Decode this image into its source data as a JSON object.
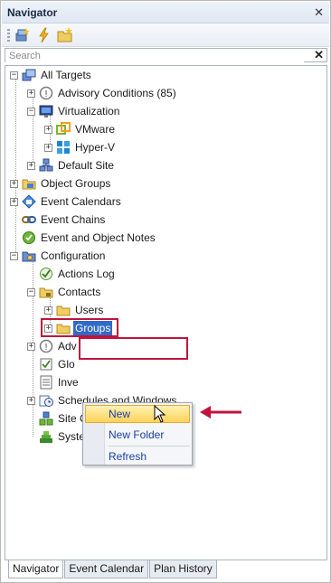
{
  "panel": {
    "title": "Navigator",
    "close_glyph": "✕"
  },
  "toolbar": {
    "buttons": [
      "new-object-icon",
      "lightning-icon",
      "new-folder-icon"
    ]
  },
  "search": {
    "placeholder": "Search",
    "value": "",
    "clear_glyph": "✕"
  },
  "tree": {
    "nodes": [
      {
        "label": "All Targets",
        "icon": "targets-icon",
        "expander": "−"
      },
      {
        "label": "Advisory Conditions (85)",
        "icon": "advisory-icon",
        "expander": "+"
      },
      {
        "label": "Virtualization",
        "icon": "monitor-icon",
        "expander": "−"
      },
      {
        "label": "VMware",
        "icon": "vmware-icon",
        "expander": "+"
      },
      {
        "label": "Hyper-V",
        "icon": "hyperv-icon",
        "expander": "+"
      },
      {
        "label": "Default Site",
        "icon": "site-icon",
        "expander": "+"
      },
      {
        "label": "Object Groups",
        "icon": "object-groups-icon",
        "expander": "+"
      },
      {
        "label": "Event Calendars",
        "icon": "calendar-icon",
        "expander": "+"
      },
      {
        "label": "Event Chains",
        "icon": "chain-icon",
        "expander": ""
      },
      {
        "label": "Event and Object Notes",
        "icon": "notes-icon",
        "expander": ""
      },
      {
        "label": "Configuration",
        "icon": "configuration-icon",
        "expander": "−"
      },
      {
        "label": "Actions Log",
        "icon": "log-icon",
        "expander": ""
      },
      {
        "label": "Contacts",
        "icon": "folder-icon",
        "expander": "−"
      },
      {
        "label": "Users",
        "icon": "folder-icon",
        "expander": "+"
      },
      {
        "label": "Groups",
        "icon": "folder-icon",
        "expander": "+"
      },
      {
        "label": "Adv",
        "icon": "advisory-icon",
        "expander": "+"
      },
      {
        "label": "Glo",
        "icon": "checklist-icon",
        "expander": ""
      },
      {
        "label": "Inve",
        "icon": "inventory-icon",
        "expander": ""
      },
      {
        "label": "Schedules and Windows",
        "icon": "schedule-icon",
        "expander": "+"
      },
      {
        "label": "Site Configuration",
        "icon": "site-config-icon",
        "expander": ""
      },
      {
        "label": "System Status",
        "icon": "system-status-icon",
        "expander": ""
      }
    ]
  },
  "context_menu": {
    "items": [
      "New",
      "New Folder",
      "Refresh"
    ]
  },
  "tabs": [
    "Navigator",
    "Event Calendar",
    "Plan History"
  ],
  "colors": {
    "selection": "#3169c6",
    "highlight_border": "#c0143c",
    "menu_hover": "#ffd35a",
    "arrow": "#c0143c"
  }
}
